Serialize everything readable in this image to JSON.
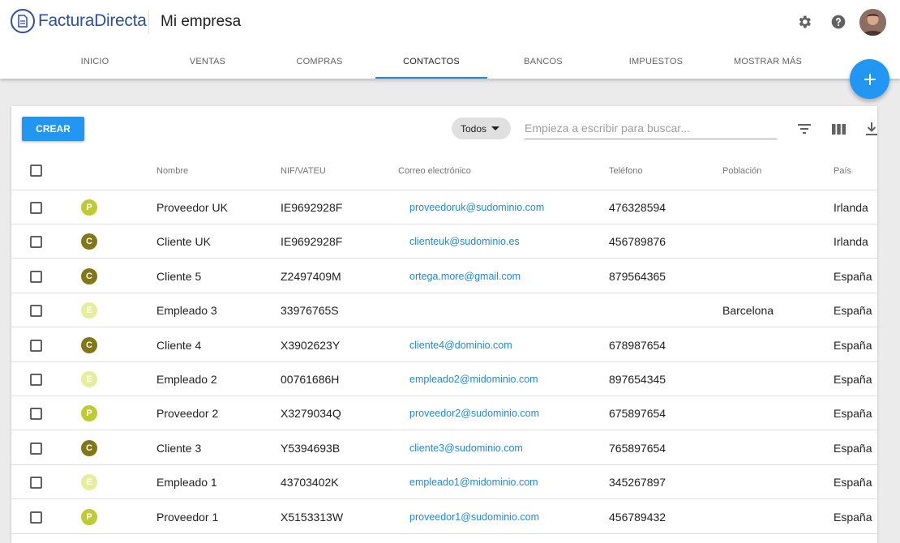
{
  "header": {
    "brand": "FacturaDirecta",
    "company": "Mi empresa",
    "icons": {
      "settings": "gear-icon",
      "help": "help-icon"
    }
  },
  "tabs": [
    {
      "label": "INICIO",
      "active": false
    },
    {
      "label": "VENTAS",
      "active": false
    },
    {
      "label": "COMPRAS",
      "active": false
    },
    {
      "label": "CONTACTOS",
      "active": true
    },
    {
      "label": "BANCOS",
      "active": false
    },
    {
      "label": "IMPUESTOS",
      "active": false
    },
    {
      "label": "MOSTRAR MÁS",
      "active": false
    }
  ],
  "toolbar": {
    "create_label": "CREAR",
    "filter_value": "Todos",
    "search_placeholder": "Empieza a escribir para buscar...",
    "icons": [
      "filter-icon",
      "columns-icon",
      "download-icon"
    ]
  },
  "table": {
    "columns": [
      "Nombre",
      "NIF/VATEU",
      "Correo electrónico",
      "Teléfono",
      "Población",
      "País"
    ],
    "badge_colors": {
      "P": "#c0ca33",
      "C": "#827717",
      "E": "#e6ee9c"
    },
    "rows": [
      {
        "badge": "P",
        "name": "Proveedor UK",
        "nif": "IE9692928F",
        "email": "proveedoruk@sudominio.com",
        "phone": "476328594",
        "city": "",
        "country": "Irlanda"
      },
      {
        "badge": "C",
        "name": "Cliente UK",
        "nif": "IE9692928F",
        "email": "clienteuk@sudominio.es",
        "phone": "456789876",
        "city": "",
        "country": "Irlanda"
      },
      {
        "badge": "C",
        "name": "Cliente 5",
        "nif": "Z2497409M",
        "email": "ortega.more@gmail.com",
        "phone": "879564365",
        "city": "",
        "country": "España"
      },
      {
        "badge": "E",
        "name": "Empleado 3",
        "nif": "33976765S",
        "email": "",
        "phone": "",
        "city": "Barcelona",
        "country": "España"
      },
      {
        "badge": "C",
        "name": "Cliente 4",
        "nif": "X3902623Y",
        "email": "cliente4@dominio.com",
        "phone": "678987654",
        "city": "",
        "country": "España"
      },
      {
        "badge": "E",
        "name": "Empleado 2",
        "nif": "00761686H",
        "email": "empleado2@midominio.com",
        "phone": "897654345",
        "city": "",
        "country": "España"
      },
      {
        "badge": "P",
        "name": "Proveedor 2",
        "nif": "X3279034Q",
        "email": "proveedor2@sudominio.com",
        "phone": "675897654",
        "city": "",
        "country": "España"
      },
      {
        "badge": "C",
        "name": "Cliente 3",
        "nif": "Y5394693B",
        "email": "cliente3@sudominio.com",
        "phone": "765897654",
        "city": "",
        "country": "España"
      },
      {
        "badge": "E",
        "name": "Empleado 1",
        "nif": "43703402K",
        "email": "empleado1@midominio.com",
        "phone": "345267897",
        "city": "",
        "country": "España"
      },
      {
        "badge": "P",
        "name": "Proveedor 1",
        "nif": "X5153313W",
        "email": "proveedor1@sudominio.com",
        "phone": "456789432",
        "city": "",
        "country": "España"
      }
    ]
  }
}
